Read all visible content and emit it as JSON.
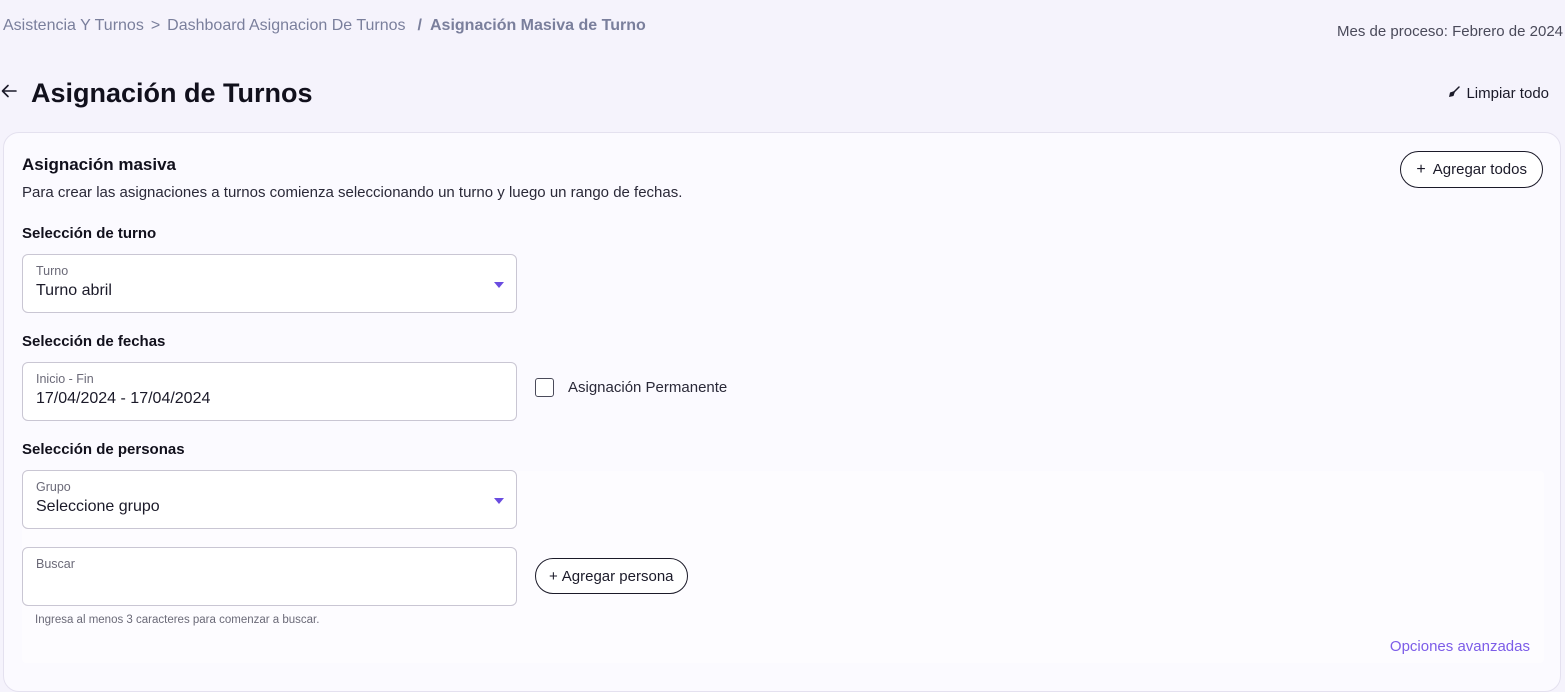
{
  "breadcrumb": {
    "items": [
      "Asistencia Y Turnos",
      "Dashboard Asignacion De Turnos"
    ],
    "separator": ">",
    "current_separator": "/",
    "current": "Asignación Masiva de Turno"
  },
  "header": {
    "process_month": "Mes de proceso: Febrero de 2024",
    "title": "Asignación de Turnos",
    "clear_all": "Limpiar todo",
    "back_icon": "arrow-left-icon",
    "clear_icon": "broom-icon"
  },
  "card": {
    "title": "Asignación masiva",
    "description": "Para crear las asignaciones a turnos comienza seleccionando un turno y luego un rango de fechas.",
    "add_all": {
      "icon": "+",
      "label": "Agregar todos"
    },
    "shift_section": {
      "label": "Selección de turno",
      "field_label": "Turno",
      "value": "Turno abril"
    },
    "dates_section": {
      "label": "Selección de fechas",
      "field_label": "Inicio - Fin",
      "value": "17/04/2024 - 17/04/2024",
      "permanent_label": "Asignación Permanente",
      "permanent_checked": false
    },
    "people_section": {
      "label": "Selección de personas",
      "group_label": "Grupo",
      "group_value": "Seleccione grupo",
      "search_label": "Buscar",
      "search_value": "",
      "add_person": {
        "icon": "+",
        "label": "Agregar persona"
      },
      "helper": "Ingresa al menos 3 caracteres para comenzar a buscar.",
      "advanced_options": "Opciones avanzadas"
    }
  },
  "colors": {
    "background": "#f5f3fc",
    "accent": "#7c5ce8",
    "caret": "#6a4ce0",
    "text": "#1b1a29",
    "muted": "#7a7f9c"
  }
}
